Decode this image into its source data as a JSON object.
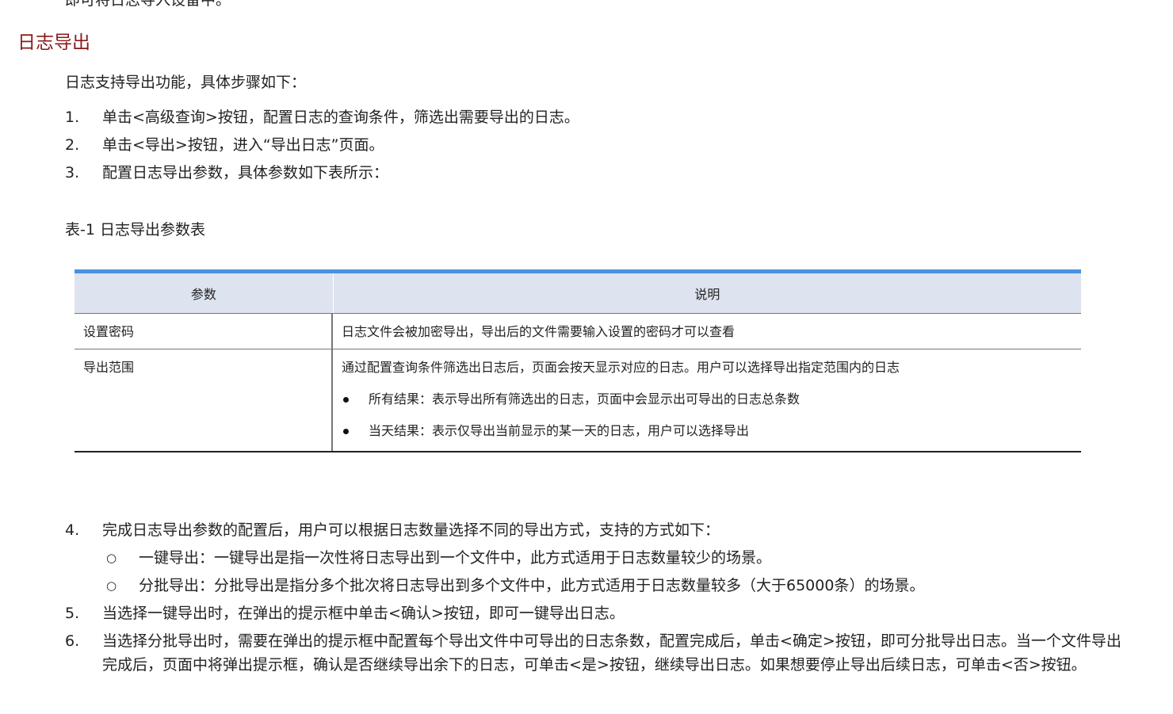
{
  "top_fragment": "即可将日志导入设备中。",
  "heading": "日志导出",
  "intro": "日志支持导出功能，具体步骤如下：",
  "steps_before": [
    {
      "num": "1.",
      "text": "单击<高级查询>按钮，配置日志的查询条件，筛选出需要导出的日志。"
    },
    {
      "num": "2.",
      "text": "单击<导出>按钮，进入“导出日志”页面。"
    },
    {
      "num": "3.",
      "text": "配置日志导出参数，具体参数如下表所示："
    }
  ],
  "table": {
    "caption": "表-1 日志导出参数表",
    "headers": [
      "参数",
      "说明"
    ],
    "rows": [
      {
        "param": "设置密码",
        "desc": "日志文件会被加密导出，导出后的文件需要输入设置的密码才可以查看",
        "bullets": []
      },
      {
        "param": "导出范围",
        "desc": "通过配置查询条件筛选出日志后，页面会按天显示对应的日志。用户可以选择导出指定范围内的日志",
        "bullets": [
          "所有结果：表示导出所有筛选出的日志，页面中会显示出可导出的日志总条数",
          "当天结果：表示仅导出当前显示的某一天的日志，用户可以选择导出"
        ]
      }
    ]
  },
  "step4": {
    "num": "4.",
    "text": "完成日志导出参数的配置后，用户可以根据日志数量选择不同的导出方式，支持的方式如下："
  },
  "sub_bullets": [
    {
      "mark": "○",
      "text": "一键导出：一键导出是指一次性将日志导出到一个文件中，此方式适用于日志数量较少的场景。"
    },
    {
      "mark": "○",
      "text": "分批导出：分批导出是指分多个批次将日志导出到多个文件中，此方式适用于日志数量较多（大于65000条）的场景。"
    }
  ],
  "step5": {
    "num": "5.",
    "text": "当选择一键导出时，在弹出的提示框中单击<确认>按钮，即可一键导出日志。"
  },
  "step6": {
    "num": "6.",
    "text": "当选择分批导出时，需要在弹出的提示框中配置每个导出文件中可导出的日志条数，配置完成后，单击<确定>按钮，即可分批导出日志。当一个文件导出完成后，页面中将弹出提示框，确认是否继续导出余下的日志，可单击<是>按钮，继续导出日志。如果想要停止导出后续日志，可单击<否>按钮。"
  }
}
